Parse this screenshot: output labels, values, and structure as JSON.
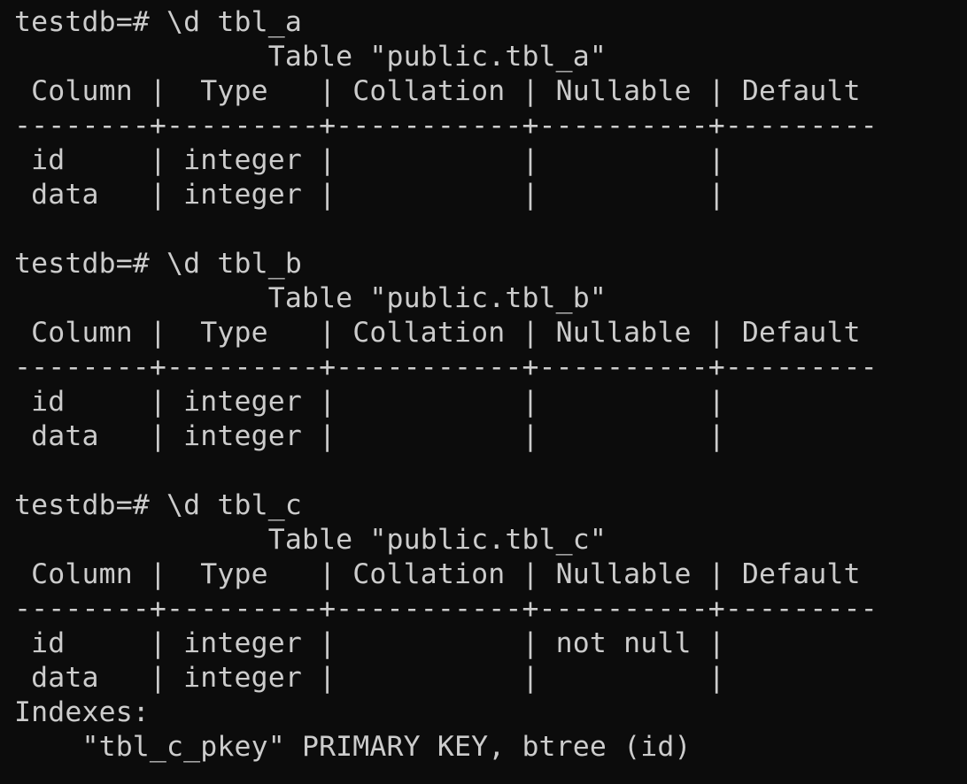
{
  "terminal": {
    "background": "#0c0c0c",
    "foreground": "#cccccc",
    "blocks": [
      {
        "command": "testdb=# \\d tbl_a",
        "lines": [
          "               Table \"public.tbl_a\"",
          " Column |  Type   | Collation | Nullable | Default",
          "--------+---------+-----------+----------+---------",
          " id     | integer |           |          |",
          " data   | integer |           |          |"
        ]
      },
      {
        "command": "testdb=# \\d tbl_b",
        "lines": [
          "               Table \"public.tbl_b\"",
          " Column |  Type   | Collation | Nullable | Default",
          "--------+---------+-----------+----------+---------",
          " id     | integer |           |          |",
          " data   | integer |           |          |"
        ]
      },
      {
        "command": "testdb=# \\d tbl_c",
        "lines": [
          "               Table \"public.tbl_c\"",
          " Column |  Type   | Collation | Nullable | Default",
          "--------+---------+-----------+----------+---------",
          " id     | integer |           | not null |",
          " data   | integer |           |          |",
          "Indexes:",
          "    \"tbl_c_pkey\" PRIMARY KEY, btree (id)"
        ]
      }
    ]
  }
}
